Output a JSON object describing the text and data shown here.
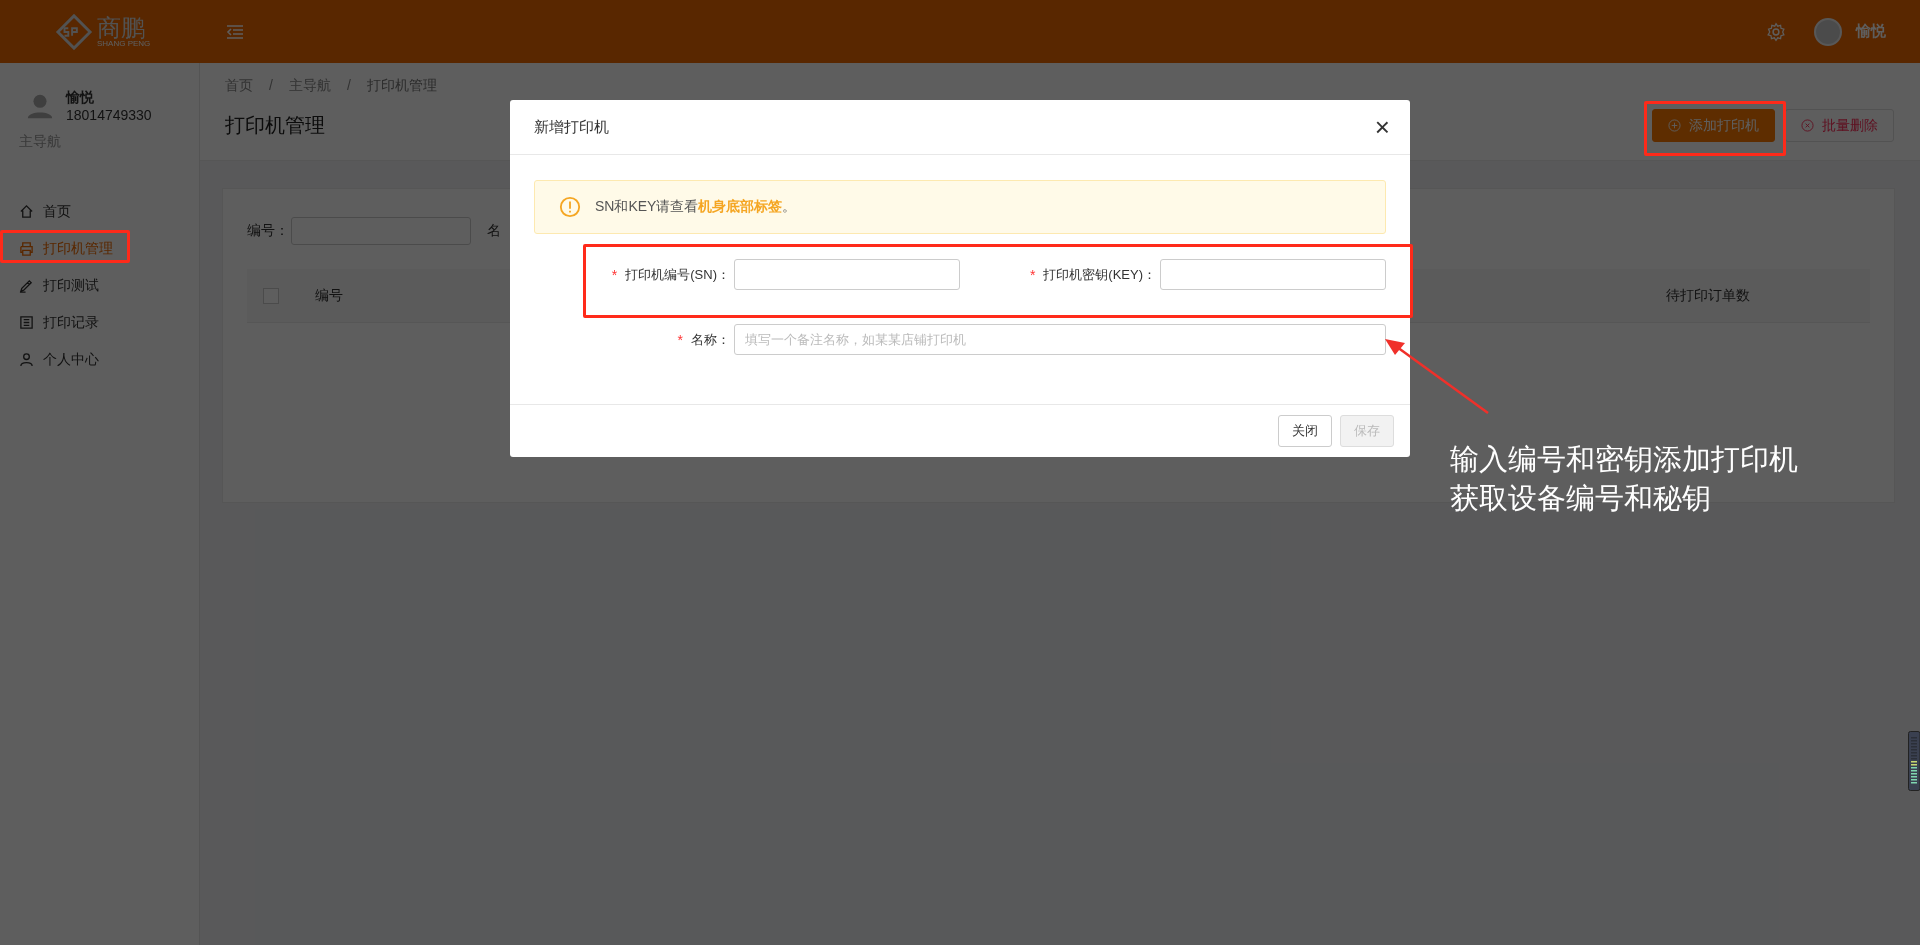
{
  "header": {
    "logo_text": "商鹏",
    "logo_subtext": "SHANG PENG",
    "user_name": "愉悦"
  },
  "sidebar": {
    "user": {
      "name": "愉悦",
      "phone": "18014749330"
    },
    "section": "主导航",
    "items": [
      {
        "label": "首页",
        "selected": false
      },
      {
        "label": "打印机管理",
        "selected": true
      },
      {
        "label": "打印测试",
        "selected": false
      },
      {
        "label": "打印记录",
        "selected": false
      },
      {
        "label": "个人中心",
        "selected": false
      }
    ]
  },
  "breadcrumb": [
    "首页",
    "主导航",
    "打印机管理"
  ],
  "breadcrumb_separators": [
    "/",
    "/"
  ],
  "page_title": "打印机管理",
  "toolbar": [
    {
      "label": "添加打印机",
      "kind": "primary"
    },
    {
      "label": "批量删除",
      "kind": "danger"
    }
  ],
  "filter": [
    {
      "label": "编号："
    },
    {
      "label": "名"
    }
  ],
  "table": {
    "select_all": {
      "checked": false
    },
    "columns": [
      "编号",
      "待打印订单数"
    ]
  },
  "dialog": {
    "title": "新增打印机",
    "close": "×",
    "alert": "SN和KEY请查看**机身底部标签**。",
    "fields": [
      {
        "mark": "*",
        "label": "打印机编号(SN)："
      },
      {
        "mark": "*",
        "label": "打印机密钥(KEY)："
      },
      {
        "mark": "*",
        "label": "名称：",
        "placeholder": "填写一个备注名称，如某某店铺打印机"
      }
    ],
    "buttons": [
      {
        "label": "关闭",
        "disabled": false
      },
      {
        "label": "保存",
        "disabled": true
      }
    ]
  },
  "annotation": [
    "输入编号和密钥添加打印机",
    "获取设备编号和秘钥"
  ]
}
